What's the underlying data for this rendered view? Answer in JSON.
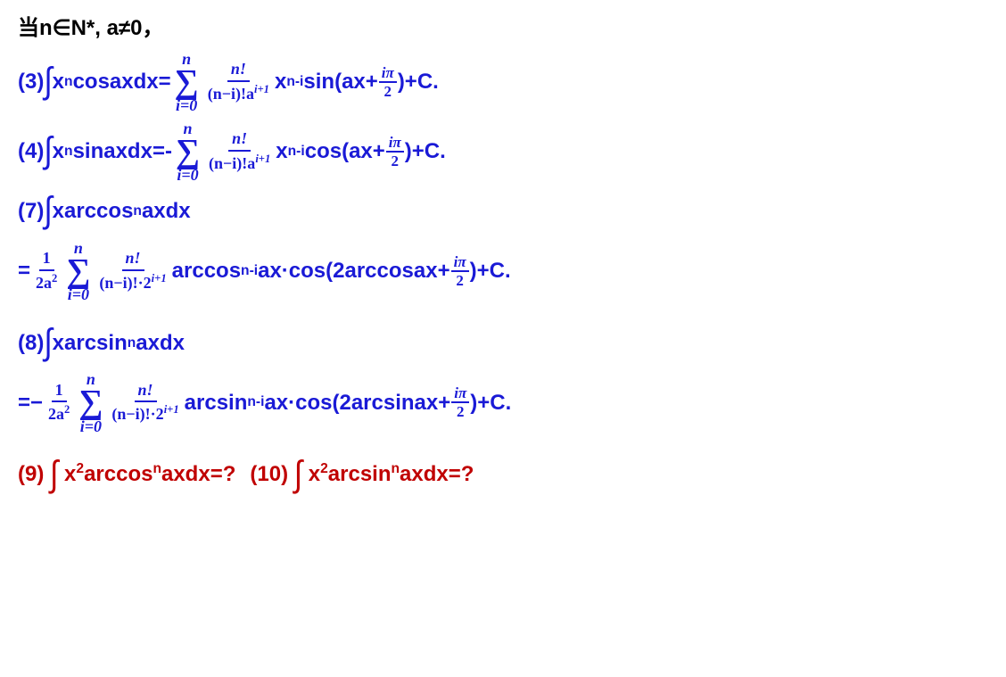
{
  "header": "当n∈N*, a≠0，",
  "f3": {
    "label": "(3)",
    "lhs_before": "x",
    "lhs_sup": "n",
    "lhs_after": "cosaxdx=",
    "sum_top": "n",
    "sum_bottom": "i=0",
    "frac_num": "n!",
    "frac_den_a": "(n−i)!a",
    "frac_den_exp": "i+1",
    "rhs_x": "x",
    "rhs_sup": "n-i",
    "rhs_sin": "sin(ax+",
    "inner_num": "iπ",
    "inner_den": "2",
    "tail": ")+C."
  },
  "f4": {
    "label": "(4)",
    "lhs_before": "x",
    "lhs_sup": "n",
    "lhs_after": "sinaxdx=-",
    "sum_top": "n",
    "sum_bottom": "i=0",
    "frac_num": "n!",
    "frac_den_a": "(n−i)!a",
    "frac_den_exp": "i+1",
    "rhs_x": "x",
    "rhs_sup": "n-i",
    "rhs_cos": "cos(ax+",
    "inner_num": "iπ",
    "inner_den": "2",
    "tail": ")+C."
  },
  "f7": {
    "label": "(7)",
    "lhs_before": "xarccos",
    "lhs_sup": "n",
    "lhs_after": "axdx",
    "eq": "=",
    "pref_num": "1",
    "pref_den_a": "2a",
    "pref_den_exp": "2",
    "sum_top": "n",
    "sum_bottom": "i=0",
    "frac_num": "n!",
    "frac_den_a": "(n−i)!·2",
    "frac_den_exp": "i+1",
    "rhs_func": "arccos",
    "rhs_sup": "n-i",
    "rhs_mid": "ax·cos(2arccosax+",
    "inner_num": "iπ",
    "inner_den": "2",
    "tail": ")+C."
  },
  "f8": {
    "label": "(8)",
    "lhs_before": "xarcsin",
    "lhs_sup": "n",
    "lhs_after": "axdx",
    "eq": "=−",
    "pref_num": "1",
    "pref_den_a": "2a",
    "pref_den_exp": "2",
    "sum_top": "n",
    "sum_bottom": "i=0",
    "frac_num": "n!",
    "frac_den_a": "(n−i)!·2",
    "frac_den_exp": "i+1",
    "rhs_func": "arcsin",
    "rhs_sup": "n-i",
    "rhs_mid": "ax·cos(2arcsinax+",
    "inner_num": "iπ",
    "inner_den": "2",
    "tail": ")+C."
  },
  "f9": {
    "label": "(9)",
    "lhs_x": "x",
    "lhs_sup": "2",
    "lhs_func": "arccos",
    "lhs_sup2": "n",
    "tail": "axdx=?"
  },
  "f10": {
    "label": "(10)",
    "lhs_x": "x",
    "lhs_sup": "2",
    "lhs_func": "arcsin",
    "lhs_sup2": "n",
    "tail": "axdx=?"
  }
}
